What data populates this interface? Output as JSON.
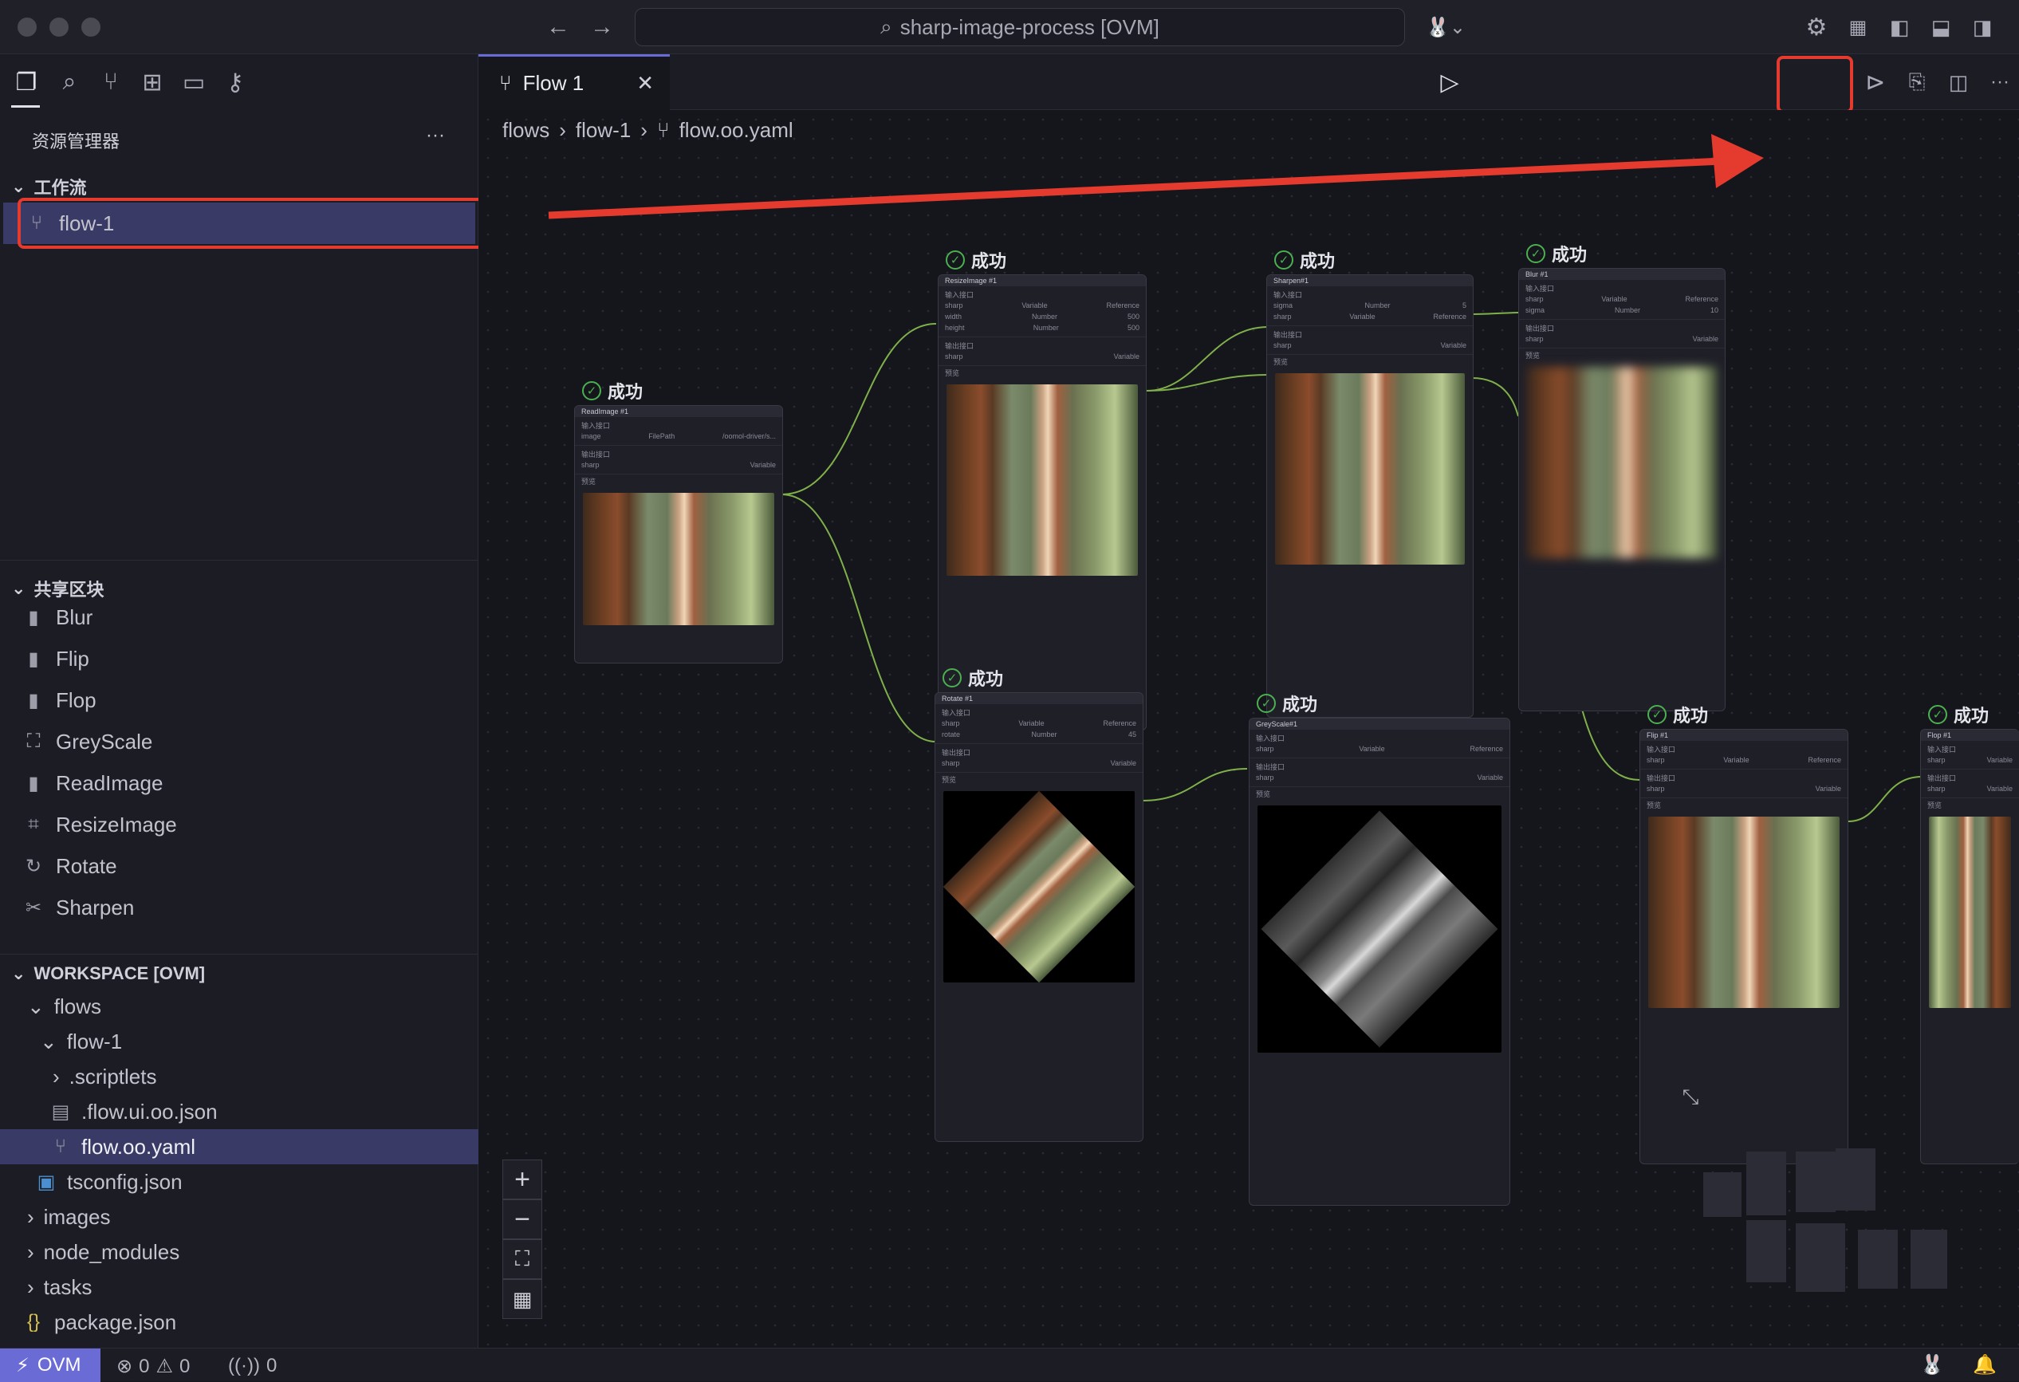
{
  "titlebar": {
    "title": "sharp-image-process [OVM]"
  },
  "sidebar": {
    "title": "资源管理器",
    "more": "···",
    "workflow_section": "工作流",
    "workflow_item": "flow-1",
    "shared_section": "共享区块",
    "shared_items": [
      {
        "label": "Blur",
        "icon": "file-icon"
      },
      {
        "label": "Flip",
        "icon": "file-icon"
      },
      {
        "label": "Flop",
        "icon": "file-icon"
      },
      {
        "label": "GreyScale",
        "icon": "crop-frame-icon"
      },
      {
        "label": "ReadImage",
        "icon": "file-read-icon"
      },
      {
        "label": "ResizeImage",
        "icon": "crop-icon"
      },
      {
        "label": "Rotate",
        "icon": "rotate-icon"
      },
      {
        "label": "Sharpen",
        "icon": "scissors-icon"
      }
    ],
    "workspace_section": "WORKSPACE [OVM]",
    "tree": [
      {
        "label": "flows"
      },
      {
        "label": "flow-1"
      },
      {
        "label": ".scriptlets"
      },
      {
        "label": ".flow.ui.oo.json"
      },
      {
        "label": "flow.oo.yaml"
      },
      {
        "label": "tsconfig.json"
      },
      {
        "label": "images"
      },
      {
        "label": "node_modules"
      },
      {
        "label": "tasks"
      },
      {
        "label": "package.json"
      }
    ]
  },
  "editor": {
    "tab_label": "Flow 1",
    "breadcrumb": [
      "flows",
      "flow-1",
      "flow.oo.yaml"
    ]
  },
  "nodes": {
    "status": "成功",
    "read": {
      "title": "ReadImage #1",
      "sec_in": "输入接口",
      "sec_out": "输出接口",
      "sec_prev": "预览",
      "in_rows": [
        {
          "name": "image",
          "type": "FilePath",
          "val": "/oomol-driver/s..."
        }
      ],
      "out_rows": [
        {
          "name": "sharp",
          "type": "Variable"
        }
      ]
    },
    "resize": {
      "title": "ResizeImage #1",
      "in_rows": [
        {
          "name": "sharp",
          "type": "Variable",
          "val": "Reference"
        },
        {
          "name": "width",
          "type": "Number",
          "val": "500"
        },
        {
          "name": "height",
          "type": "Number",
          "val": "500"
        }
      ],
      "out_rows": [
        {
          "name": "sharp",
          "type": "Variable"
        }
      ]
    },
    "sharpen": {
      "title": "Sharpen#1",
      "in_rows": [
        {
          "name": "sigma",
          "type": "Number",
          "val": "5"
        },
        {
          "name": "sharp",
          "type": "Variable",
          "val": "Reference"
        }
      ],
      "out_rows": [
        {
          "name": "sharp",
          "type": "Variable"
        }
      ]
    },
    "blur": {
      "title": "Blur #1",
      "in_rows": [
        {
          "name": "sharp",
          "type": "Variable",
          "val": "Reference"
        },
        {
          "name": "sigma",
          "type": "Number",
          "val": "10"
        }
      ],
      "out_rows": [
        {
          "name": "sharp",
          "type": "Variable"
        }
      ]
    },
    "rotate": {
      "title": "Rotate #1",
      "in_rows": [
        {
          "name": "sharp",
          "type": "Variable",
          "val": "Reference"
        },
        {
          "name": "rotate",
          "type": "Number",
          "val": "45"
        }
      ],
      "out_rows": [
        {
          "name": "sharp",
          "type": "Variable"
        }
      ]
    },
    "grey": {
      "title": "GreyScale#1",
      "in_rows": [
        {
          "name": "sharp",
          "type": "Variable",
          "val": "Reference"
        }
      ],
      "out_rows": [
        {
          "name": "sharp",
          "type": "Variable"
        }
      ]
    },
    "flip": {
      "title": "Flip #1",
      "in_rows": [
        {
          "name": "sharp",
          "type": "Variable",
          "val": "Reference"
        }
      ],
      "out_rows": [
        {
          "name": "sharp",
          "type": "Variable"
        }
      ]
    },
    "flop": {
      "title": "Flop #1",
      "in_rows": [
        {
          "name": "sharp",
          "type": "Variable",
          "val": "Reference"
        }
      ],
      "out_rows": [
        {
          "name": "sharp",
          "type": "Variable"
        }
      ]
    }
  },
  "statusbar": {
    "ovm": "OVM",
    "errors": "0",
    "warnings": "0",
    "ports": "0"
  },
  "colors": {
    "accent": "#6b6bd6",
    "annotation": "#e53a2e",
    "success": "#4caf50",
    "edge": "#7fb04a"
  }
}
